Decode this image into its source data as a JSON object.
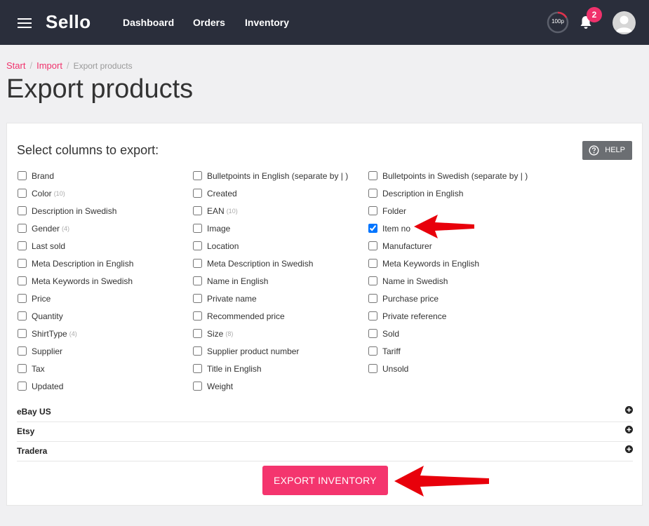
{
  "app": {
    "logo": "Sello"
  },
  "nav": [
    {
      "label": "Dashboard"
    },
    {
      "label": "Orders"
    },
    {
      "label": "Inventory"
    }
  ],
  "topbar": {
    "gauge_label": "100p",
    "notification_count": "2"
  },
  "breadcrumb": [
    {
      "label": "Start"
    },
    {
      "label": "Import"
    },
    {
      "label": "Export products"
    }
  ],
  "page": {
    "title": "Export products"
  },
  "export": {
    "heading": "Select columns to export:",
    "help_label": "HELP",
    "button_label": "EXPORT INVENTORY",
    "columns": [
      [
        {
          "label": "Brand",
          "count": "",
          "checked": false
        },
        {
          "label": "Color",
          "count": "(10)",
          "checked": false
        },
        {
          "label": "Description in Swedish",
          "count": "",
          "checked": false
        },
        {
          "label": "Gender",
          "count": "(4)",
          "checked": false
        },
        {
          "label": "Last sold",
          "count": "",
          "checked": false
        },
        {
          "label": "Meta Description in English",
          "count": "",
          "checked": false
        },
        {
          "label": "Meta Keywords in Swedish",
          "count": "",
          "checked": false
        },
        {
          "label": "Price",
          "count": "",
          "checked": false
        },
        {
          "label": "Quantity",
          "count": "",
          "checked": false
        },
        {
          "label": "ShirtType",
          "count": "(4)",
          "checked": false
        },
        {
          "label": "Supplier",
          "count": "",
          "checked": false
        },
        {
          "label": "Tax",
          "count": "",
          "checked": false
        },
        {
          "label": "Updated",
          "count": "",
          "checked": false
        }
      ],
      [
        {
          "label": "Bulletpoints in English (separate by | )",
          "count": "",
          "checked": false
        },
        {
          "label": "Created",
          "count": "",
          "checked": false
        },
        {
          "label": "EAN",
          "count": "(10)",
          "checked": false
        },
        {
          "label": "Image",
          "count": "",
          "checked": false
        },
        {
          "label": "Location",
          "count": "",
          "checked": false
        },
        {
          "label": "Meta Description in Swedish",
          "count": "",
          "checked": false
        },
        {
          "label": "Name in English",
          "count": "",
          "checked": false
        },
        {
          "label": "Private name",
          "count": "",
          "checked": false
        },
        {
          "label": "Recommended price",
          "count": "",
          "checked": false
        },
        {
          "label": "Size",
          "count": "(8)",
          "checked": false
        },
        {
          "label": "Supplier product number",
          "count": "",
          "checked": false
        },
        {
          "label": "Title in English",
          "count": "",
          "checked": false
        },
        {
          "label": "Weight",
          "count": "",
          "checked": false
        }
      ],
      [
        {
          "label": "Bulletpoints in Swedish (separate by | )",
          "count": "",
          "checked": false
        },
        {
          "label": "Description in English",
          "count": "",
          "checked": false
        },
        {
          "label": "Folder",
          "count": "",
          "checked": false
        },
        {
          "label": "Item no",
          "count": "",
          "checked": true
        },
        {
          "label": "Manufacturer",
          "count": "",
          "checked": false
        },
        {
          "label": "Meta Keywords in English",
          "count": "",
          "checked": false
        },
        {
          "label": "Name in Swedish",
          "count": "",
          "checked": false
        },
        {
          "label": "Purchase price",
          "count": "",
          "checked": false
        },
        {
          "label": "Private reference",
          "count": "",
          "checked": false
        },
        {
          "label": "Sold",
          "count": "",
          "checked": false
        },
        {
          "label": "Tariff",
          "count": "",
          "checked": false
        },
        {
          "label": "Unsold",
          "count": "",
          "checked": false
        }
      ]
    ],
    "channels": [
      {
        "label": "eBay US"
      },
      {
        "label": "Etsy"
      },
      {
        "label": "Tradera"
      }
    ]
  },
  "colors": {
    "topbar": "#2a2e3b",
    "accent": "#f0326c",
    "annotation_arrow": "#e8000b"
  }
}
